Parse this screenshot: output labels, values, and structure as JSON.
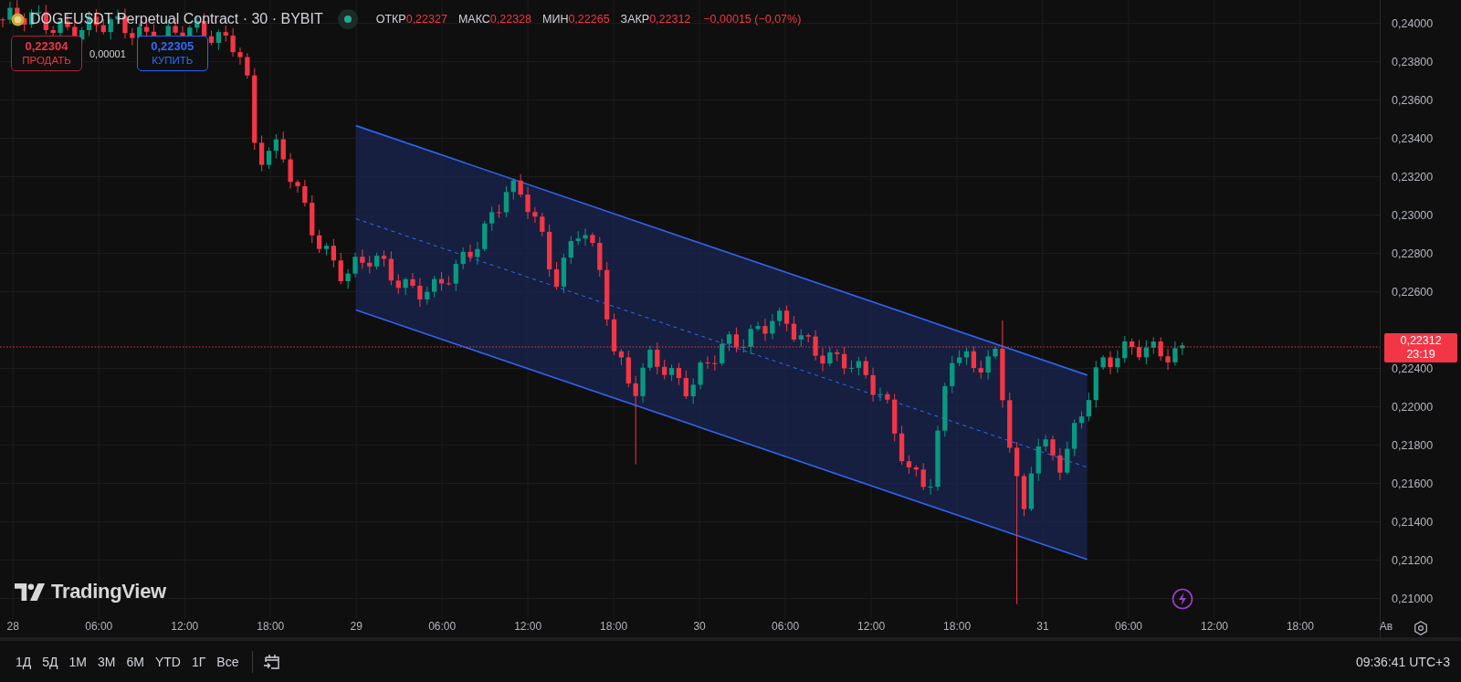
{
  "symbol": {
    "title": "DOGEUSDT Perpetual Contract · 30 · BYBIT",
    "market_open": true
  },
  "ohlc": [
    {
      "label": "ОТКР",
      "value": "0,22327"
    },
    {
      "label": "МАКС",
      "value": "0,22328"
    },
    {
      "label": "МИН",
      "value": "0,22265"
    },
    {
      "label": "ЗАКР",
      "value": "0,22312"
    }
  ],
  "change": "−0,00015 (−0,07%)",
  "trade": {
    "sell": {
      "price": "0,22304",
      "label": "ПРОДАТЬ"
    },
    "spread": "0,00001",
    "buy": {
      "price": "0,22305",
      "label": "КУПИТЬ"
    }
  },
  "price_axis": {
    "labels": [
      "0,24000",
      "0,23800",
      "0,23600",
      "0,23400",
      "0,23200",
      "0,23000",
      "0,22800",
      "0,22600",
      "0,22400",
      "0,22000",
      "0,21800",
      "0,21600",
      "0,21400",
      "0,21200",
      "0,21000"
    ]
  },
  "last_price": {
    "price": "0,22312",
    "countdown": "23:19"
  },
  "time_axis": {
    "labels": [
      "28",
      "06:00",
      "12:00",
      "18:00",
      "29",
      "06:00",
      "12:00",
      "18:00",
      "30",
      "06:00",
      "12:00",
      "18:00",
      "31",
      "06:00",
      "12:00",
      "18:00",
      "Ав"
    ]
  },
  "logo": {
    "text": "TradingView"
  },
  "ranges": [
    {
      "label": "1Д"
    },
    {
      "label": "5Д"
    },
    {
      "label": "1М"
    },
    {
      "label": "3М"
    },
    {
      "label": "6М"
    },
    {
      "label": "YTD"
    },
    {
      "label": "1Г"
    },
    {
      "label": "Все"
    }
  ],
  "clock": "09:36:41 UTC+3"
}
